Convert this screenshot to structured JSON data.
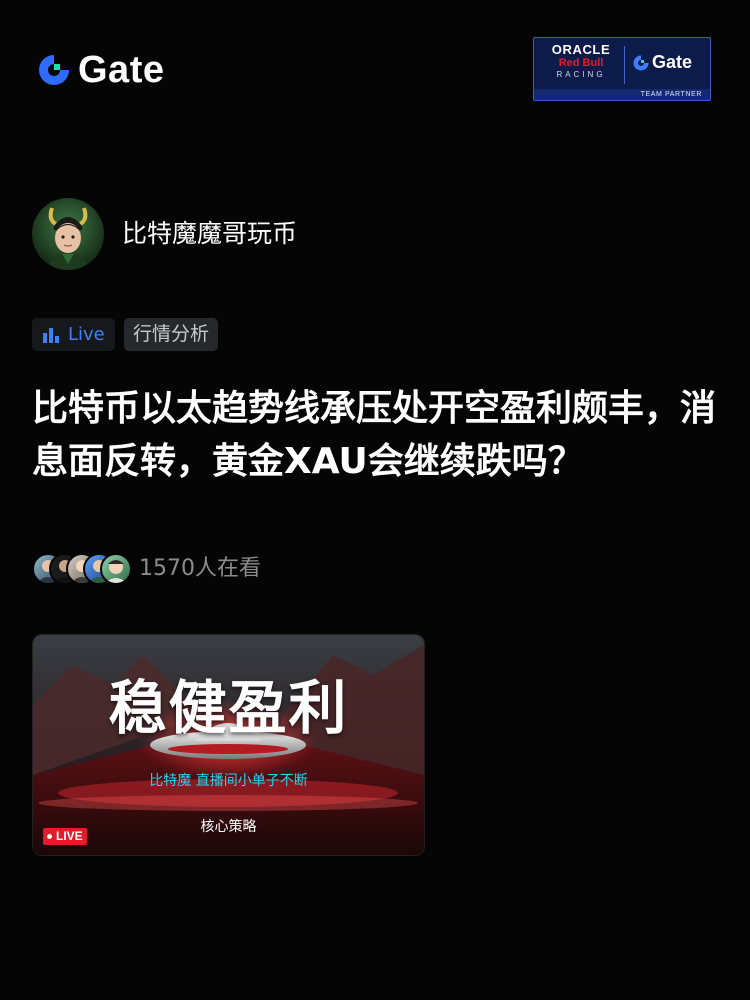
{
  "header": {
    "logo_text": "Gate",
    "partner": {
      "line1": "ORACLE",
      "line2": "Red Bull",
      "line3": "RACING",
      "brand": "Gate",
      "footer": "TEAM PARTNER"
    }
  },
  "author": {
    "name": "比特魔魔哥玩币",
    "avatar_icon": "avatar-character-horns"
  },
  "tags": {
    "live_label": "Live",
    "category": "行情分析"
  },
  "post": {
    "title": "比特币以太趋势线承压处开空盈利颇丰，消息面反转，黄金XAU会继续跌吗？"
  },
  "viewers": {
    "count_text": "1570人在看"
  },
  "thumbnail": {
    "headline": "稳健盈利",
    "subtitle": "比特魔  直播间小单子不断",
    "caption": "核心策略",
    "live_badge": "LIVE"
  },
  "colors": {
    "background": "#050505",
    "accent_blue": "#3b82f6",
    "live_red": "#e11d2a",
    "cyan_text": "#22d3ee",
    "muted_text": "#8c8c8c"
  }
}
